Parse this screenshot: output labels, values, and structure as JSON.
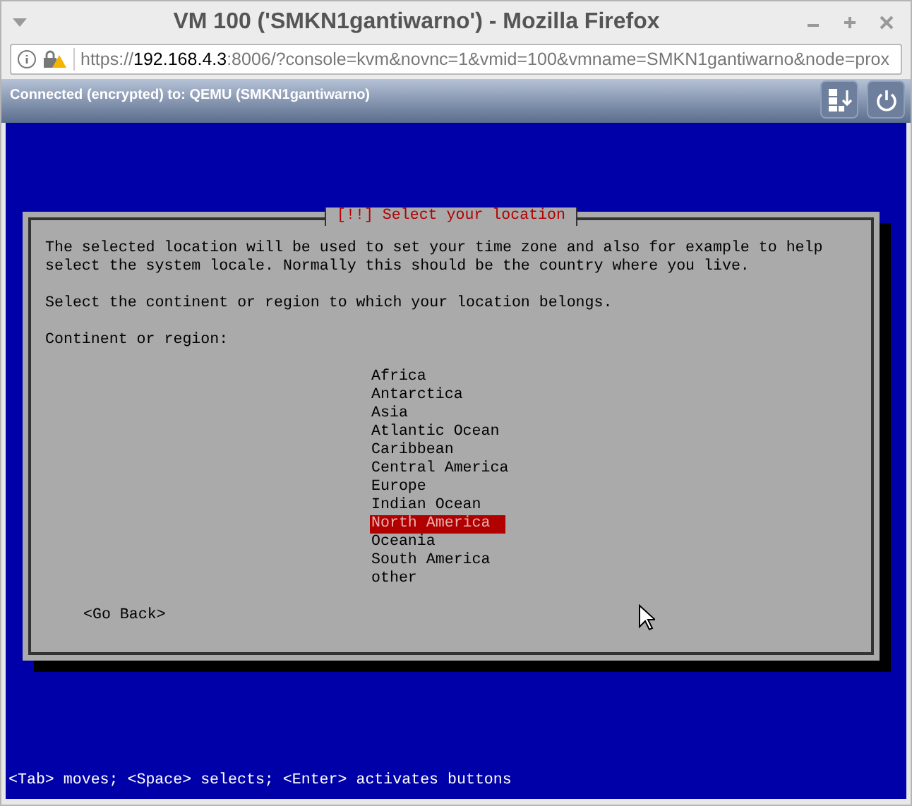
{
  "window": {
    "title": "VM 100 ('SMKN1gantiwarno') - Mozilla Firefox"
  },
  "address_bar": {
    "url_prefix": "https://",
    "url_host": "192.168.4.3",
    "url_rest": ":8006/?console=kvm&novnc=1&vmid=100&vmname=SMKN1gantiwarno&node=prox"
  },
  "vnc_bar": {
    "status": "Connected (encrypted) to: QEMU (SMKN1gantiwarno)"
  },
  "dialog": {
    "title": "[!!] Select your location",
    "description": [
      "The selected location will be used to set your time zone and also for example to help",
      "select the system locale. Normally this should be the country where you live."
    ],
    "prompt": "Select the continent or region to which your location belongs.",
    "list_label": "Continent or region:",
    "items": [
      {
        "label": "Africa",
        "selected": false
      },
      {
        "label": "Antarctica",
        "selected": false
      },
      {
        "label": "Asia",
        "selected": false
      },
      {
        "label": "Atlantic Ocean",
        "selected": false
      },
      {
        "label": "Caribbean",
        "selected": false
      },
      {
        "label": "Central America",
        "selected": false
      },
      {
        "label": "Europe",
        "selected": false
      },
      {
        "label": "Indian Ocean",
        "selected": false
      },
      {
        "label": "North America",
        "selected": true
      },
      {
        "label": "Oceania",
        "selected": false
      },
      {
        "label": "South America",
        "selected": false
      },
      {
        "label": "other",
        "selected": false
      }
    ],
    "button": "<Go Back>"
  },
  "status_line": "<Tab> moves; <Space> selects; <Enter> activates buttons"
}
